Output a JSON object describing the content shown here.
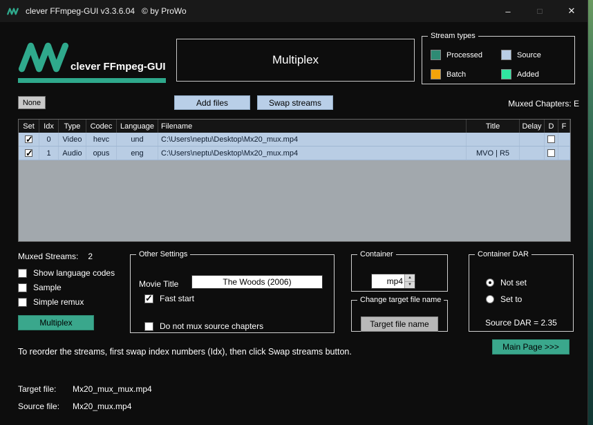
{
  "titlebar": {
    "title": "clever FFmpeg-GUI v3.3.6.04   © by ProWo",
    "minimize_glyph": "–",
    "maximize_glyph": "□",
    "close_glyph": "✕"
  },
  "colors": {
    "accent_teal": "#2fa98c",
    "row_blue": "#b9cde4",
    "annotation_red": "#dd0000"
  },
  "header": {
    "logo_text": "clever FFmpeg-GUI",
    "page_title": "Multiplex",
    "stream_types": {
      "label": "Stream types",
      "items": [
        {
          "label": "Processed",
          "color": "#2e8b74"
        },
        {
          "label": "Source",
          "color": "#b9cde4"
        },
        {
          "label": "Batch",
          "color": "#f2a30a"
        },
        {
          "label": "Added",
          "color": "#30e6a0"
        }
      ]
    }
  },
  "toolbar": {
    "none_button": "None",
    "add_files_button": "Add files",
    "swap_streams_button": "Swap streams",
    "muxed_chapters": "Muxed Chapters: E"
  },
  "table": {
    "columns": [
      "Set",
      "Idx",
      "Type",
      "Codec",
      "Language",
      "Filename",
      "Title",
      "Delay",
      "D",
      "F"
    ],
    "rows": [
      {
        "set": true,
        "idx": "0",
        "type": "Video",
        "codec": "hevc",
        "language": "und",
        "filename": "C:\\Users\\neptu\\Desktop\\Mx20_mux.mp4",
        "title": "",
        "delay": "",
        "d": false
      },
      {
        "set": true,
        "idx": "1",
        "type": "Audio",
        "codec": "opus",
        "language": "eng",
        "filename": "C:\\Users\\neptu\\Desktop\\Mx20_mux.mp4",
        "title": "MVO | R5",
        "delay": "",
        "d": false
      }
    ]
  },
  "left_panel": {
    "muxed_streams_label": "Muxed Streams:",
    "muxed_streams_value": "2",
    "options": [
      {
        "label": "Show language codes",
        "checked": false
      },
      {
        "label": "Sample",
        "checked": false
      },
      {
        "label": "Simple remux",
        "checked": false
      }
    ],
    "multiplex_button": "Multiplex"
  },
  "other_settings": {
    "label": "Other Settings",
    "movie_title_label": "Movie Title",
    "movie_title_value": "The Woods (2006)",
    "fast_start": {
      "label": "Fast start",
      "checked": true
    },
    "no_source_chapters": {
      "label": "Do not mux source chapters",
      "checked": false
    }
  },
  "container_box": {
    "label": "Container",
    "value": "mp4",
    "spin_up": "▲",
    "spin_down": "▼"
  },
  "target_name_box": {
    "label": "Change target file name",
    "button": "Target file name"
  },
  "dar_box": {
    "label": "Container DAR",
    "not_set": {
      "label": "Not set",
      "selected": true
    },
    "set_to": {
      "label": "Set to",
      "selected": false
    },
    "source_dar": "Source DAR = 2.35"
  },
  "footer": {
    "hint": "To reorder the streams, first swap index numbers (Idx), then click Swap streams button.",
    "main_page_button": "Main Page >>>",
    "target_file_label": "Target file:",
    "target_file_value": "Mx20_mux_mux.mp4",
    "source_file_label": "Source file:",
    "source_file_value": "Mx20_mux.mp4"
  }
}
